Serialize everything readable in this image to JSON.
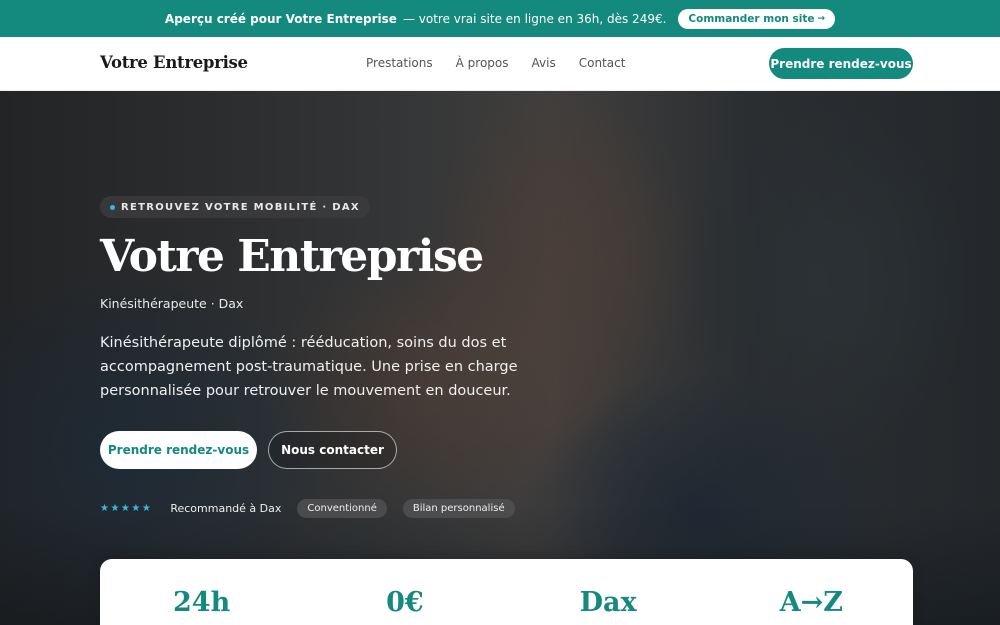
{
  "promo": {
    "highlight": "Aperçu créé pour Votre Entreprise",
    "text": " — votre vrai site en ligne en 36h, dès 249€.",
    "button_label": "Commander mon site",
    "button_icon": "→"
  },
  "header": {
    "brand": "Votre Entreprise",
    "nav": [
      "Prestations",
      "À propos",
      "Avis",
      "Contact"
    ],
    "cta": "Prendre rendez-vous"
  },
  "hero": {
    "tagline": "RETROUVEZ VOTRE MOBILITÉ · DAX",
    "title": "Votre Entreprise",
    "subtitle": "Kinésithérapeute · Dax",
    "description": "Kinésithérapeute diplômé : rééducation, soins du dos et accompagnement post-traumatique. Une prise en charge personnalisée pour retrouver le mouvement en douceur.",
    "primary_button": "Prendre rendez-vous",
    "secondary_button": "Nous contacter",
    "rating_stars": "★★★★★",
    "recommendation": "Recommandé à Dax",
    "chips": [
      "Conventionné",
      "Bilan personnalisé"
    ]
  },
  "stats": [
    "24h",
    "0€",
    "Dax",
    "A→Z"
  ],
  "colors": {
    "accent": "#14897d",
    "star": "#3fb6d8"
  }
}
